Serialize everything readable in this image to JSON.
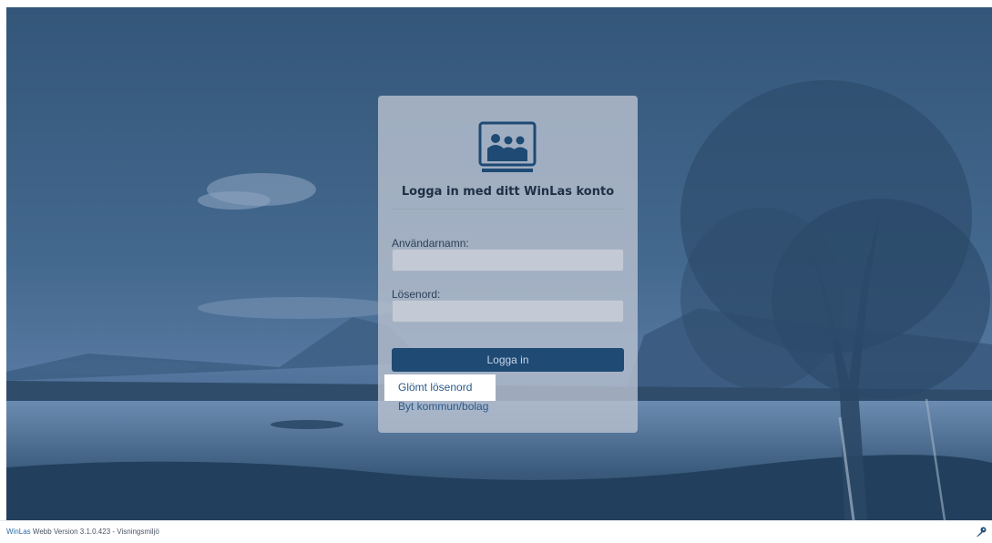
{
  "login": {
    "title": "Logga in med ditt WinLas konto",
    "username_label": "Användarnamn:",
    "username_value": "",
    "password_label": "Lösenord:",
    "password_value": "",
    "submit_label": "Logga in",
    "forgot_link": "Glömt lösenord",
    "switch_link": "Byt kommun/bolag"
  },
  "footer": {
    "brand": "WinLas",
    "version_text": " Webb Version 3.1.0.423 - Visningsmiljö"
  },
  "icons": {
    "logo": "people-group-icon",
    "footer_right": "key-icon"
  },
  "colors": {
    "primary": "#1e4a74",
    "link": "#2a5a8a",
    "brand": "#2a6aa8"
  }
}
